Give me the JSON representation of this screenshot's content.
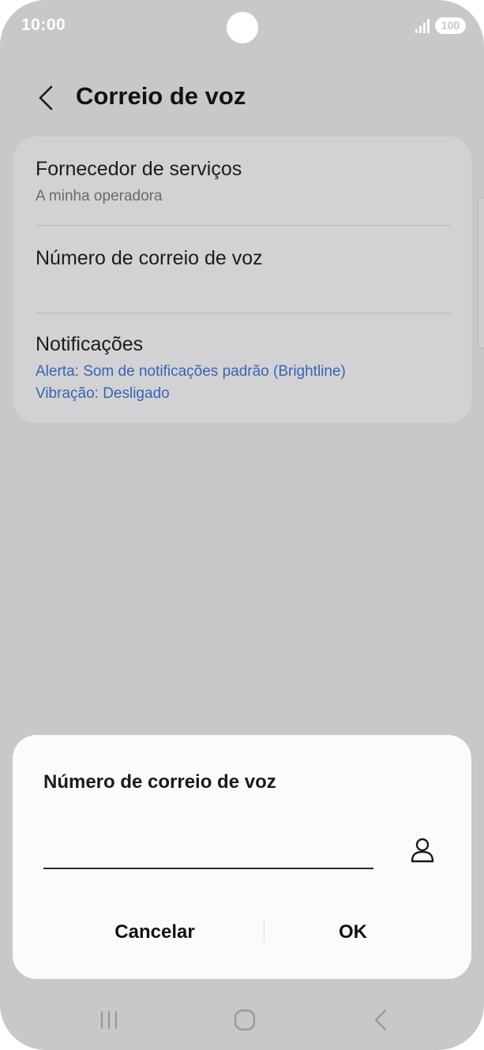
{
  "status_bar": {
    "time": "10:00",
    "battery": "100"
  },
  "header": {
    "title": "Correio de voz"
  },
  "settings": {
    "service_provider": {
      "title": "Fornecedor de serviços",
      "subtitle": "A minha operadora"
    },
    "voicemail_number": {
      "title": "Número de correio de voz"
    },
    "notifications": {
      "title": "Notificações",
      "alert": "Alerta: Som de notificações padrão (Brightline)",
      "vibration": "Vibração: Desligado"
    }
  },
  "dialog": {
    "title": "Número de correio de voz",
    "input_value": "",
    "cancel_label": "Cancelar",
    "ok_label": "OK"
  },
  "colors": {
    "background": "#c8c8ca",
    "card": "#d2d2d4",
    "dialog": "#fbfbfd",
    "accent_blue": "#3a63b5"
  },
  "icons": {
    "back": "chevron-left-icon",
    "contact": "person-icon",
    "nav_recents": "recents-icon",
    "nav_home": "home-icon",
    "nav_back": "back-icon"
  }
}
